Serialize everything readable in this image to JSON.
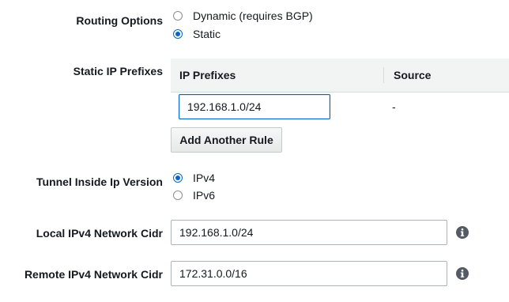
{
  "routing": {
    "label": "Routing Options",
    "options": [
      {
        "label": "Dynamic (requires BGP)",
        "selected": false
      },
      {
        "label": "Static",
        "selected": true
      }
    ]
  },
  "static_prefixes": {
    "label": "Static IP Prefixes",
    "columns": [
      "IP Prefixes",
      "Source"
    ],
    "rows": [
      {
        "prefix": "192.168.1.0/24",
        "source": "-"
      }
    ],
    "add_button": "Add Another Rule"
  },
  "tunnel_ip_version": {
    "label": "Tunnel Inside Ip Version",
    "options": [
      {
        "label": "IPv4",
        "selected": true
      },
      {
        "label": "IPv6",
        "selected": false
      }
    ]
  },
  "local_cidr": {
    "label": "Local IPv4 Network Cidr",
    "value": "192.168.1.0/24",
    "icon": "info-icon"
  },
  "remote_cidr": {
    "label": "Remote IPv4 Network Cidr",
    "value": "172.31.0.0/16",
    "icon": "info-icon"
  },
  "colors": {
    "accent": "#0a66c2",
    "header_bg": "#f2f3f3",
    "border": "#aab7b8"
  }
}
